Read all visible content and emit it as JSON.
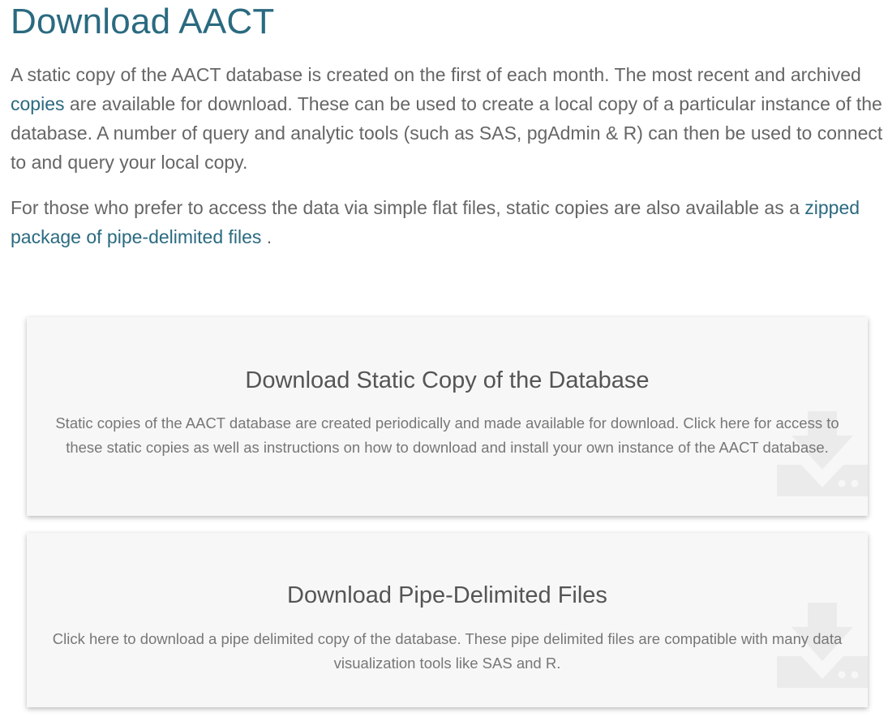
{
  "page": {
    "title": "Download AACT",
    "intro": {
      "p1_before_link": "A static copy of the AACT database is created on the first of each month. The most recent and archived ",
      "p1_link": "copies",
      "p1_after_link": "  are available for download. These can be used to create a local copy of a particular instance of the database. A number of query and analytic tools (such as SAS, pgAdmin & R) can then be used to connect to and query your local copy.",
      "p2_before_link": "For those who prefer to access the data via simple flat files, static copies are also available as a ",
      "p2_link": "zipped package of pipe-delimited files",
      "p2_after_link": " ."
    }
  },
  "cards": [
    {
      "title": "Download Static Copy of the Database",
      "description": "Static copies of the AACT database are created periodically and made available for download. Click here for access to these static copies as well as instructions on how to download and install your own instance of the AACT database.",
      "icon": "download-drive-icon"
    },
    {
      "title": "Download Pipe-Delimited Files",
      "description": "Click here to download a pipe delimited copy of the database. These pipe delimited files are compatible with many data visualization tools like SAS and R.",
      "icon": "download-drive-icon"
    }
  ],
  "colors": {
    "title": "#2a6a80",
    "link": "#2a6a80",
    "text": "#666666",
    "card_bg": "#f7f7f7",
    "icon": "#e8e8e8"
  }
}
